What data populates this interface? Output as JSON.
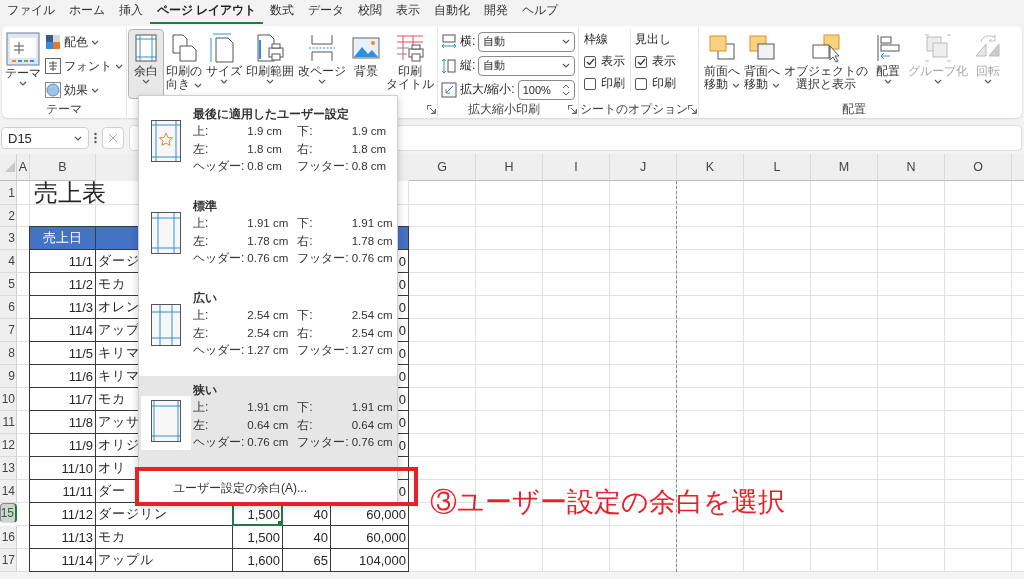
{
  "menu_tabs": [
    {
      "label": "ファイル",
      "selected": false
    },
    {
      "label": "ホーム",
      "selected": false
    },
    {
      "label": "挿入",
      "selected": false
    },
    {
      "label": "ページ レイアウト",
      "selected": true
    },
    {
      "label": "数式",
      "selected": false
    },
    {
      "label": "データ",
      "selected": false
    },
    {
      "label": "校閲",
      "selected": false
    },
    {
      "label": "表示",
      "selected": false
    },
    {
      "label": "自動化",
      "selected": false
    },
    {
      "label": "開発",
      "selected": false
    },
    {
      "label": "ヘルプ",
      "selected": false
    }
  ],
  "ribbon": {
    "theme": {
      "label": "テーマ",
      "button": {
        "label": "テーマ",
        "dropdown": true
      },
      "small_buttons": [
        {
          "label": "配色",
          "dropdown": true
        },
        {
          "label": "フォント",
          "dropdown": true
        },
        {
          "label": "効果",
          "dropdown": true
        }
      ]
    },
    "page_setup": {
      "launcher": true,
      "buttons": [
        {
          "lines": [
            "余白"
          ],
          "dropdown": true,
          "pressed": true
        },
        {
          "lines": [
            "印刷の",
            "向き"
          ],
          "dropdown": true,
          "pressed": false
        },
        {
          "lines": [
            "サイズ"
          ],
          "dropdown": true,
          "pressed": false
        },
        {
          "lines": [
            "印刷範囲"
          ],
          "dropdown": true,
          "pressed": false
        },
        {
          "lines": [
            "改ページ"
          ],
          "dropdown": true,
          "pressed": false
        },
        {
          "lines": [
            "背景"
          ],
          "dropdown": false,
          "pressed": false
        },
        {
          "lines": [
            "印刷",
            "タイトル"
          ],
          "dropdown": false,
          "pressed": false
        }
      ]
    },
    "scale": {
      "label": "拡大縮小印刷",
      "launcher": true,
      "fields": [
        {
          "kind": "select",
          "label": "横:",
          "value": "自動"
        },
        {
          "kind": "select",
          "label": "縦:",
          "value": "自動"
        },
        {
          "kind": "spin",
          "label": "拡大/縮小:",
          "value": "100%"
        }
      ]
    },
    "sheet_options": {
      "label": "シートのオプション",
      "launcher": true,
      "columns": [
        {
          "title": "枠線",
          "options": [
            {
              "label": "表示",
              "checked": true
            },
            {
              "label": "印刷",
              "checked": false
            }
          ]
        },
        {
          "title": "見出し",
          "options": [
            {
              "label": "表示",
              "checked": true
            },
            {
              "label": "印刷",
              "checked": false
            }
          ]
        }
      ]
    },
    "arrange": {
      "label": "配置",
      "buttons": [
        {
          "lines": [
            "前面へ",
            "移動"
          ],
          "dropdown": true,
          "disabled": false
        },
        {
          "lines": [
            "背面へ",
            "移動"
          ],
          "dropdown": true,
          "disabled": false
        },
        {
          "lines": [
            "オブジェクトの",
            "選択と表示"
          ],
          "dropdown": false,
          "disabled": false
        },
        {
          "lines": [
            "配置"
          ],
          "dropdown": true,
          "disabled": false
        },
        {
          "lines": [
            "グループ化"
          ],
          "dropdown": true,
          "disabled": true
        },
        {
          "lines": [
            "回転"
          ],
          "dropdown": true,
          "disabled": true
        }
      ]
    }
  },
  "formula_bar": {
    "name_box": "D15"
  },
  "sheet": {
    "columns": [
      {
        "kind": "letter",
        "letter": "A"
      },
      {
        "kind": "letter",
        "letter": "B"
      },
      {
        "kind": "covered"
      },
      {
        "kind": "covered"
      },
      {
        "kind": "covered"
      },
      {
        "kind": "covered"
      },
      {
        "kind": "letter",
        "letter": "G"
      },
      {
        "kind": "letter",
        "letter": "H"
      },
      {
        "kind": "letter",
        "letter": "I"
      },
      {
        "kind": "letter",
        "letter": "J"
      },
      {
        "kind": "letter",
        "letter": "K",
        "page_break": true
      },
      {
        "kind": "letter",
        "letter": "L"
      },
      {
        "kind": "letter",
        "letter": "M"
      },
      {
        "kind": "letter",
        "letter": "N"
      },
      {
        "kind": "letter",
        "letter": "O"
      }
    ],
    "rows": [
      {
        "number": "1",
        "selected": false,
        "cells": [
          {
            "kind": "empty"
          },
          {
            "kind": "title",
            "text": "売上表"
          }
        ]
      },
      {
        "number": "2",
        "selected": false,
        "cells": []
      },
      {
        "number": "3",
        "selected": false,
        "cells": [
          {
            "kind": "empty"
          },
          {
            "kind": "header",
            "text": "売上日"
          },
          {
            "kind": "header"
          },
          {
            "kind": "covered"
          },
          {
            "kind": "covered"
          },
          {
            "kind": "header"
          }
        ]
      },
      {
        "number": "4",
        "selected": false,
        "cells": [
          {
            "kind": "empty"
          },
          {
            "kind": "number",
            "text": "11/1"
          },
          {
            "kind": "text",
            "text": "ダージ"
          },
          {
            "kind": "covered"
          },
          {
            "kind": "covered"
          },
          {
            "kind": "number",
            "text": "0"
          }
        ]
      },
      {
        "number": "5",
        "selected": false,
        "cells": [
          {
            "kind": "empty"
          },
          {
            "kind": "number",
            "text": "11/2"
          },
          {
            "kind": "text",
            "text": "モカ"
          },
          {
            "kind": "covered"
          },
          {
            "kind": "covered"
          },
          {
            "kind": "number",
            "text": "0"
          }
        ]
      },
      {
        "number": "6",
        "selected": false,
        "cells": [
          {
            "kind": "empty"
          },
          {
            "kind": "number",
            "text": "11/3"
          },
          {
            "kind": "text",
            "text": "オレン"
          },
          {
            "kind": "covered"
          },
          {
            "kind": "covered"
          },
          {
            "kind": "number",
            "text": "0"
          }
        ]
      },
      {
        "number": "7",
        "selected": false,
        "cells": [
          {
            "kind": "empty"
          },
          {
            "kind": "number",
            "text": "11/4"
          },
          {
            "kind": "text",
            "text": "アップ"
          },
          {
            "kind": "covered"
          },
          {
            "kind": "covered"
          },
          {
            "kind": "number",
            "text": "0"
          }
        ]
      },
      {
        "number": "8",
        "selected": false,
        "cells": [
          {
            "kind": "empty"
          },
          {
            "kind": "number",
            "text": "11/5"
          },
          {
            "kind": "text",
            "text": "キリマ"
          },
          {
            "kind": "covered"
          },
          {
            "kind": "covered"
          },
          {
            "kind": "number",
            "text": "0"
          }
        ]
      },
      {
        "number": "9",
        "selected": false,
        "cells": [
          {
            "kind": "empty"
          },
          {
            "kind": "number",
            "text": "11/6"
          },
          {
            "kind": "text",
            "text": "キリマ"
          },
          {
            "kind": "covered"
          },
          {
            "kind": "covered"
          },
          {
            "kind": "number",
            "text": "0"
          }
        ]
      },
      {
        "number": "10",
        "selected": false,
        "cells": [
          {
            "kind": "empty"
          },
          {
            "kind": "number",
            "text": "11/7"
          },
          {
            "kind": "text",
            "text": "モカ"
          },
          {
            "kind": "covered"
          },
          {
            "kind": "covered"
          },
          {
            "kind": "number",
            "text": "0"
          }
        ]
      },
      {
        "number": "11",
        "selected": false,
        "cells": [
          {
            "kind": "empty"
          },
          {
            "kind": "number",
            "text": "11/8"
          },
          {
            "kind": "text",
            "text": "アッサ"
          },
          {
            "kind": "covered"
          },
          {
            "kind": "covered"
          },
          {
            "kind": "number",
            "text": "0"
          }
        ]
      },
      {
        "number": "12",
        "selected": false,
        "cells": [
          {
            "kind": "empty"
          },
          {
            "kind": "number",
            "text": "11/9"
          },
          {
            "kind": "text",
            "text": "オリジ"
          },
          {
            "kind": "covered"
          },
          {
            "kind": "covered"
          },
          {
            "kind": "number",
            "text": "0"
          }
        ]
      },
      {
        "number": "13",
        "selected": false,
        "cells": [
          {
            "kind": "empty"
          },
          {
            "kind": "number",
            "text": "11/10"
          },
          {
            "kind": "text",
            "text": "オリ"
          },
          {
            "kind": "covered"
          },
          {
            "kind": "covered"
          },
          {
            "kind": "number"
          }
        ]
      },
      {
        "number": "14",
        "selected": false,
        "cells": [
          {
            "kind": "empty"
          },
          {
            "kind": "number",
            "text": "11/11"
          },
          {
            "kind": "text",
            "text": "ダー"
          },
          {
            "kind": "covered"
          },
          {
            "kind": "covered"
          },
          {
            "kind": "number",
            "text": "0"
          }
        ]
      },
      {
        "number": "15",
        "selected": true,
        "cells": [
          {
            "kind": "empty"
          },
          {
            "kind": "number",
            "text": "11/12"
          },
          {
            "kind": "text",
            "text": "ダージリン"
          },
          {
            "kind": "number",
            "text": "1,500",
            "active": true
          },
          {
            "kind": "number",
            "text": "40"
          },
          {
            "kind": "number",
            "text": "60,000"
          }
        ]
      },
      {
        "number": "16",
        "selected": false,
        "cells": [
          {
            "kind": "empty"
          },
          {
            "kind": "number",
            "text": "11/13"
          },
          {
            "kind": "text",
            "text": "モカ"
          },
          {
            "kind": "number",
            "text": "1,500"
          },
          {
            "kind": "number",
            "text": "40"
          },
          {
            "kind": "number",
            "text": "60,000"
          }
        ]
      },
      {
        "number": "17",
        "selected": false,
        "cells": [
          {
            "kind": "empty"
          },
          {
            "kind": "number",
            "text": "11/14"
          },
          {
            "kind": "text",
            "text": "アップル"
          },
          {
            "kind": "number",
            "text": "1,600"
          },
          {
            "kind": "number",
            "text": "65"
          },
          {
            "kind": "number",
            "text": "104,000"
          }
        ]
      }
    ]
  },
  "margins_menu": {
    "presets": [
      {
        "kind": "custom",
        "title": "最後に適用したユーザー設定",
        "selected": false,
        "fields": [
          {
            "label": "上:",
            "value": "1.9 cm"
          },
          {
            "label": "下:",
            "value": "1.9 cm"
          },
          {
            "label": "左:",
            "value": "1.8 cm"
          },
          {
            "label": "右:",
            "value": "1.8 cm"
          },
          {
            "label": "ヘッダー:",
            "value": "0.8 cm"
          },
          {
            "label": "フッター:",
            "value": "0.8 cm"
          }
        ]
      },
      {
        "kind": "preset",
        "title": "標準",
        "selected": false,
        "fields": [
          {
            "label": "上:",
            "value": "1.91 cm"
          },
          {
            "label": "下:",
            "value": "1.91 cm"
          },
          {
            "label": "左:",
            "value": "1.78 cm"
          },
          {
            "label": "右:",
            "value": "1.78 cm"
          },
          {
            "label": "ヘッダー:",
            "value": "0.76 cm"
          },
          {
            "label": "フッター:",
            "value": "0.76 cm"
          }
        ]
      },
      {
        "kind": "preset",
        "title": "広い",
        "selected": false,
        "fields": [
          {
            "label": "上:",
            "value": "2.54 cm"
          },
          {
            "label": "下:",
            "value": "2.54 cm"
          },
          {
            "label": "左:",
            "value": "2.54 cm"
          },
          {
            "label": "右:",
            "value": "2.54 cm"
          },
          {
            "label": "ヘッダー:",
            "value": "1.27 cm"
          },
          {
            "label": "フッター:",
            "value": "1.27 cm"
          }
        ]
      },
      {
        "kind": "preset",
        "title": "狭い",
        "selected": true,
        "fields": [
          {
            "label": "上:",
            "value": "1.91 cm"
          },
          {
            "label": "下:",
            "value": "1.91 cm"
          },
          {
            "label": "左:",
            "value": "0.64 cm"
          },
          {
            "label": "右:",
            "value": "0.64 cm"
          },
          {
            "label": "ヘッダー:",
            "value": "0.76 cm"
          },
          {
            "label": "フッター:",
            "value": "0.76 cm"
          }
        ]
      }
    ],
    "custom_item": {
      "label": "ユーザー設定の余白(A)..."
    }
  },
  "annotation": {
    "text": "③ユーザー設定の余白を選択"
  }
}
